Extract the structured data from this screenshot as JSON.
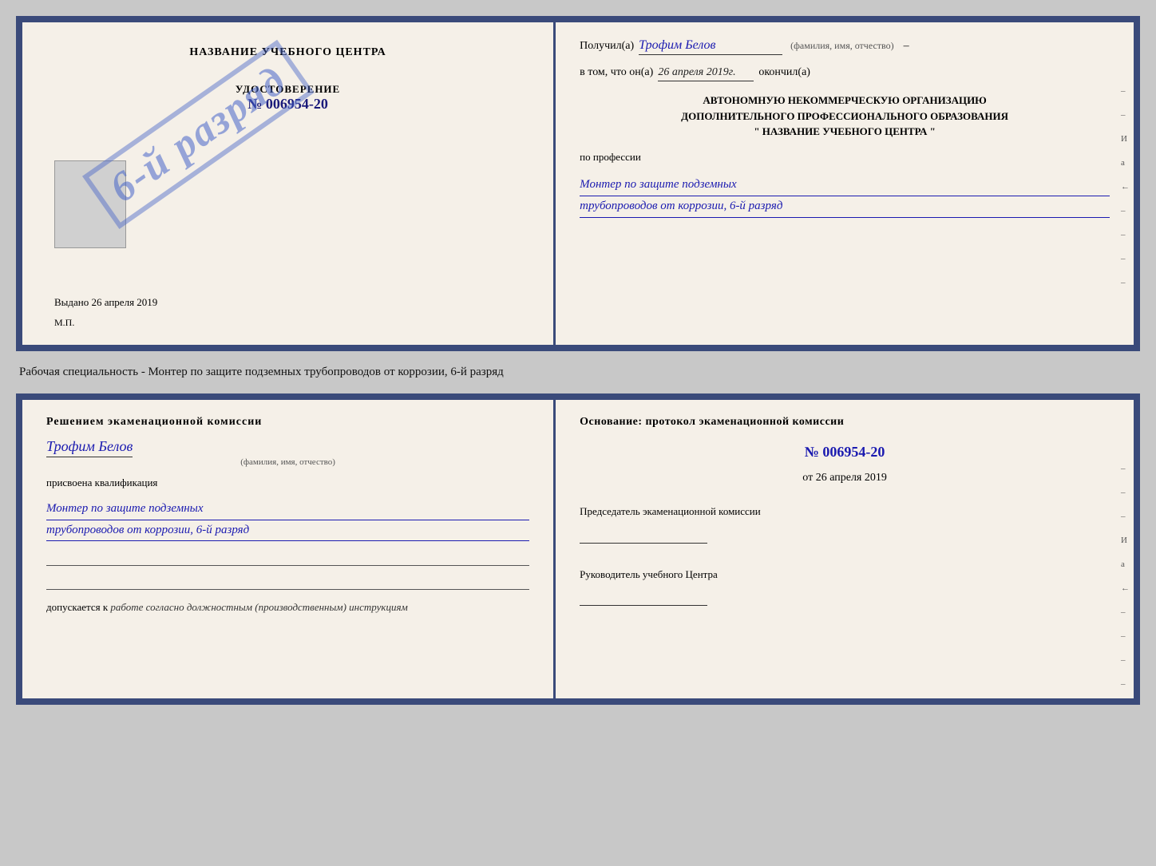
{
  "top_cert": {
    "left": {
      "center_title": "НАЗВАНИЕ УЧЕБНОГО ЦЕНТРА",
      "udostoverenie_label": "УДОСТОВЕРЕНИЕ",
      "number": "№ 006954-20",
      "stamp_text": "6-й разряд",
      "issued_label": "Выдано",
      "issued_date": "26 апреля 2019",
      "mp": "М.П."
    },
    "right": {
      "received_prefix": "Получил(а)",
      "received_name": "Трофим Белов",
      "name_hint": "(фамилия, имя, отчество)",
      "date_prefix": "в том, что он(а)",
      "date_value": "26 апреля 2019г.",
      "date_suffix": "окончил(а)",
      "org_line1": "АВТОНОМНУЮ НЕКОММЕРЧЕСКУЮ ОРГАНИЗАЦИЮ",
      "org_line2": "ДОПОЛНИТЕЛЬНОГО ПРОФЕССИОНАЛЬНОГО ОБРАЗОВАНИЯ",
      "org_line3": "\"  НАЗВАНИЕ УЧЕБНОГО ЦЕНТРА  \"",
      "profession_label": "по профессии",
      "profession_value1": "Монтер по защите подземных",
      "profession_value2": "трубопроводов от коррозии, 6-й разряд",
      "edge_marks": [
        "-",
        "-",
        "И",
        "а",
        "←",
        "-",
        "-",
        "-",
        "-"
      ]
    }
  },
  "middle_text": "Рабочая специальность - Монтер по защите подземных трубопроводов от коррозии, 6-й разряд",
  "bottom_cert": {
    "left": {
      "decision_title": "Решением экаменационной комиссии",
      "person_name": "Трофим Белов",
      "name_hint": "(фамилия, имя, отчество)",
      "assigned_text": "присвоена квалификация",
      "qualification_line1": "Монтер по защите подземных",
      "qualification_line2": "трубопроводов от коррозии, 6-й разряд",
      "допуск_prefix": "допускается к",
      "допуск_italic": "работе согласно должностным (производственным) инструкциям"
    },
    "right": {
      "basis_title": "Основание: протокол экаменационной комиссии",
      "protocol_number": "№ 006954-20",
      "protocol_date_prefix": "от",
      "protocol_date": "26 апреля 2019",
      "chairman_title": "Председатель экаменационной комиссии",
      "director_title": "Руководитель учебного Центра",
      "edge_marks": [
        "-",
        "-",
        "-",
        "И",
        "а",
        "←",
        "-",
        "-",
        "-",
        "-"
      ]
    }
  }
}
